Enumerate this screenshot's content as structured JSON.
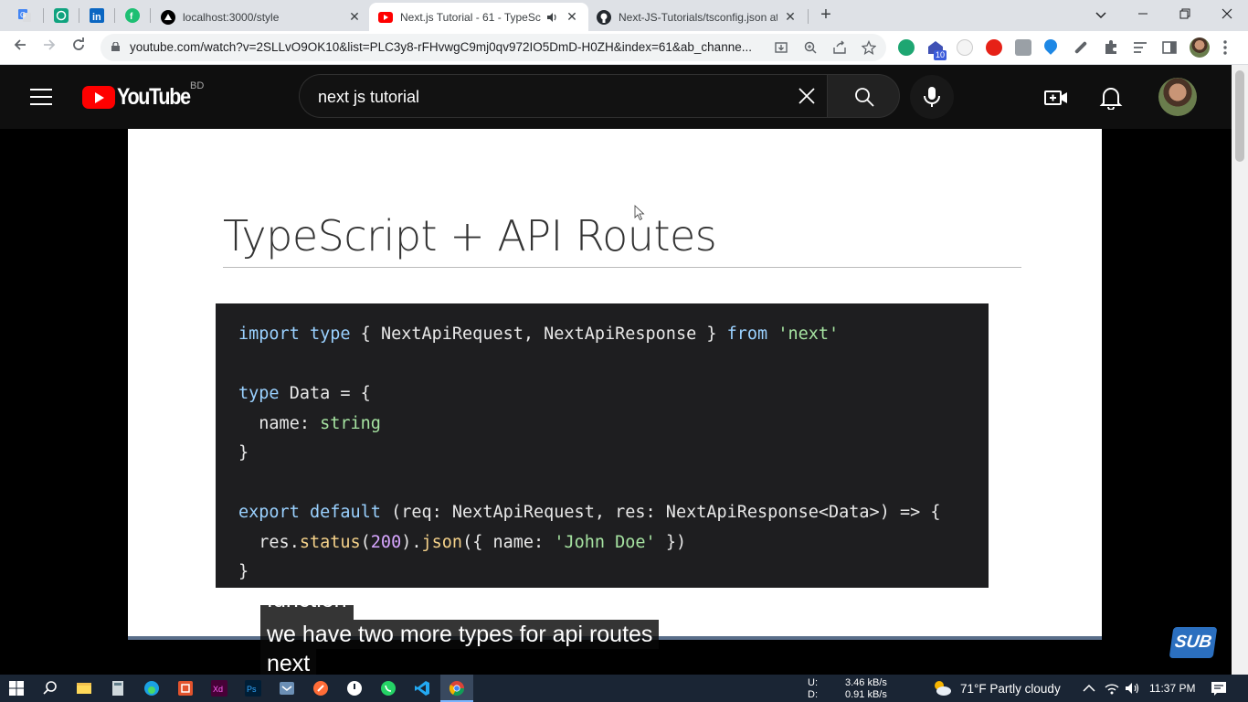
{
  "browser": {
    "tabs": [
      {
        "title": "localhost:3000/style",
        "close": "✕"
      },
      {
        "title": "Next.js Tutorial - 61 - TypeSc",
        "close": "✕"
      },
      {
        "title": "Next-JS-Tutorials/tsconfig.json at",
        "close": "✕"
      }
    ],
    "new_tab": "+",
    "url": "youtube.com/watch?v=2SLLvO9OK10&list=PLC3y8-rFHvwgC9mj0qv972IO5DmD-H0ZH&index=61&ab_channe...",
    "extension_badge": "10"
  },
  "youtube": {
    "logo": "YouTube",
    "country": "BD",
    "search_query": "next js tutorial"
  },
  "video": {
    "slide_title": "TypeScript + API Routes",
    "code": {
      "l1": {
        "kw1": "import",
        "kw2": "type",
        "mid": " { NextApiRequest, NextApiResponse } ",
        "kw3": "from",
        "str": "'next'"
      },
      "l2": {
        "kw": "type",
        "rest": " Data = {"
      },
      "l3": {
        "key": "  name: ",
        "type": "string"
      },
      "l4": "}",
      "l5": {
        "kw1": "export",
        "kw2": "default",
        "rest": " (req: NextApiRequest, res: NextApiResponse<Data>) => {"
      },
      "l6": {
        "a": "  res.",
        "fn1": "status",
        "b": "(",
        "num": "200",
        "c": ").",
        "fn2": "json",
        "d": "({ name: ",
        "str": "'John Doe'",
        "e": " })"
      },
      "l7": "}"
    },
    "captions": [
      "function",
      "we have two more types for api routes",
      "next"
    ],
    "sub_badge": "SUB"
  },
  "taskbar": {
    "net_up_label": "U:",
    "net_down_label": "D:",
    "net_up": "3.46 kB/s",
    "net_down": "0.91 kB/s",
    "weather": "71°F  Partly cloudy",
    "time": "11:37 PM"
  }
}
